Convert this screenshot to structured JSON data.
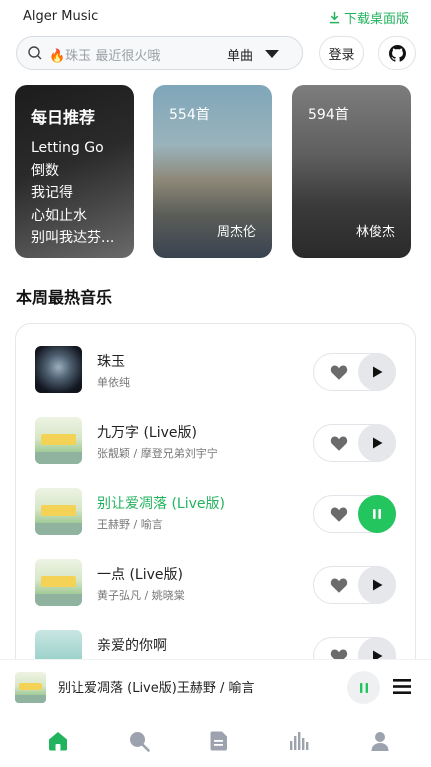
{
  "app": {
    "title": "Alger Music",
    "download_label": "下载桌面版"
  },
  "search": {
    "placeholder": "🔥珠玉 最近很火哦",
    "type": "单曲"
  },
  "header": {
    "login_label": "登录"
  },
  "daily": {
    "title": "每日推荐",
    "songs": [
      "Letting Go",
      "倒数",
      "我记得",
      "心如止水",
      "别叫我达芬..."
    ]
  },
  "artist_cards": [
    {
      "count": "554首",
      "name": "周杰伦"
    },
    {
      "count": "594首",
      "name": "林俊杰"
    }
  ],
  "section": {
    "title": "本周最热音乐"
  },
  "songs": [
    {
      "title": "珠玉",
      "artist": "单依纯",
      "thumb": "dark",
      "playing": false
    },
    {
      "title": "九万字 (Live版)",
      "artist": "张靓颖 / 摩登兄弟刘宇宁",
      "thumb": "fest",
      "playing": false
    },
    {
      "title": "别让爱凋落 (Live版)",
      "artist": "王赫野 / 喻言",
      "thumb": "fest",
      "playing": true
    },
    {
      "title": "一点 (Live版)",
      "artist": "黄子弘凡 / 姚晓棠",
      "thumb": "fest",
      "playing": false
    },
    {
      "title": "亲爱的你啊",
      "artist": "",
      "thumb": "teal",
      "playing": false
    }
  ],
  "now_playing": {
    "text": "别让爱凋落 (Live版)王赫野 / 喻言"
  },
  "tabs": [
    "home-icon",
    "search-icon",
    "playlist-icon",
    "chart-icon",
    "user-icon"
  ],
  "colors": {
    "accent": "#22b35e",
    "accent_button": "#22c55e",
    "icon_gray": "#9ca3af"
  }
}
